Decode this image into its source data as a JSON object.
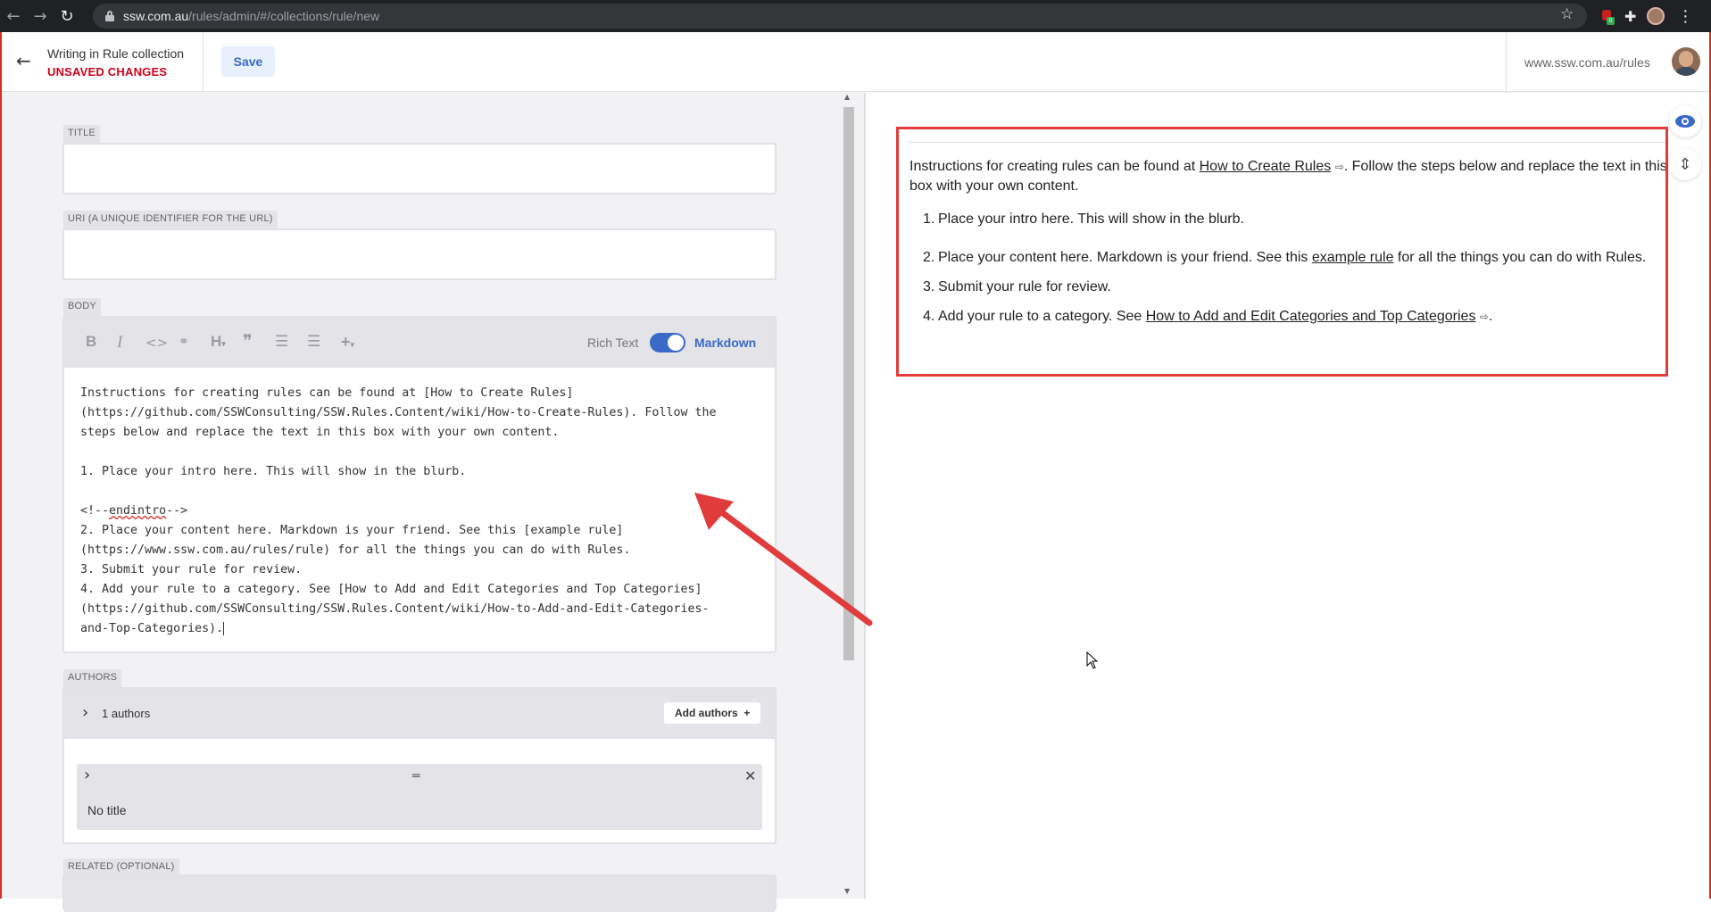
{
  "browser": {
    "url_host": "ssw.com.au",
    "url_path": "/rules/admin/#/collections/rule/new",
    "ext_badge": "0"
  },
  "header": {
    "back_icon": "←",
    "collection_title": "Writing in Rule collection",
    "unsaved_status": "UNSAVED CHANGES",
    "save_label": "Save",
    "site_link": "www.ssw.com.au/rules",
    "colors": {
      "accent": "#3a69c7",
      "unsaved": "#d0021b"
    }
  },
  "fields": {
    "title_label": "TITLE",
    "title_value": "",
    "uri_label": "URI (A UNIQUE IDENTIFIER FOR THE URL)",
    "uri_value": "",
    "body_label": "BODY",
    "authors_label": "AUTHORS",
    "related_label": "RELATED (OPTIONAL)"
  },
  "toolbar": {
    "bold_icon": "B",
    "italic_icon": "I",
    "code_icon": "<>",
    "link_icon": "🔗",
    "heading_icon": "H",
    "quote_icon": "❞",
    "bullet_icon": "☰",
    "numbered_icon": "☰",
    "plus_icon": "+",
    "mode_rich": "Rich Text",
    "mode_markdown": "Markdown",
    "markdown_enabled": true
  },
  "body_markdown": {
    "line1": "Instructions for creating rules can be found at [How to Create Rules]",
    "line2": "(https://github.com/SSWConsulting/SSW.Rules.Content/wiki/How-to-Create-Rules). Follow the",
    "line3": "steps below and replace the text in this box with your own content.",
    "line4": "1. Place your intro here. This will show in the blurb.",
    "line5_prefix": "<!--",
    "line5_word": "endintro",
    "line5_suffix": "-->",
    "line6": "2. Place your content here. Markdown is your friend. See this [example rule]",
    "line7": "(https://www.ssw.com.au/rules/rule) for all the things you can do with Rules.",
    "line8": "3. Submit your rule for review.",
    "line9": "4. Add your rule to a category. See [How to Add and Edit Categories and Top Categories]",
    "line10": "(https://github.com/SSWConsulting/SSW.Rules.Content/wiki/How-to-Add-and-Edit-Categories-",
    "line11": "and-Top-Categories)."
  },
  "authors": {
    "count_label": "1 authors",
    "add_label": "Add authors",
    "add_icon": "+",
    "item_title": "No title"
  },
  "preview": {
    "intro_before": "Instructions for creating rules can be found at ",
    "intro_link": "How to Create Rules",
    "intro_after": ". Follow the steps below and replace the text in this box with your own content.",
    "item1": "Place your intro here. This will show in the blurb.",
    "item2_before": "Place your content here. Markdown is your friend. See this ",
    "item2_link": "example rule",
    "item2_after": " for all the things you can do with Rules.",
    "item3": "Submit your rule for review.",
    "item4_before": "Add your rule to a category. See ",
    "item4_link": "How to Add and Edit Categories and Top Categories",
    "item4_after": ".",
    "num1": "1.",
    "num2": "2.",
    "num3": "3.",
    "num4": "4."
  },
  "annotation": {
    "color": "#e03c3c"
  }
}
